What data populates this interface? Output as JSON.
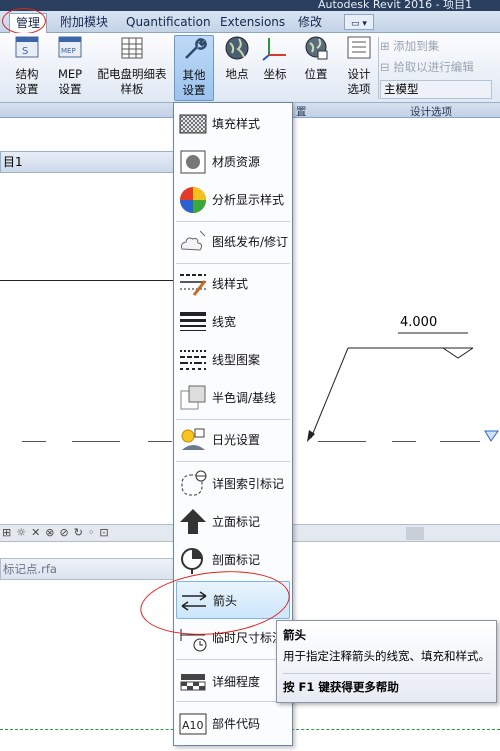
{
  "title_bar": {
    "text": "Autodesk Revit 2016 -    项目1"
  },
  "tabs": [
    {
      "label": "管理"
    },
    {
      "label": "附加模块"
    },
    {
      "label": "Quantification"
    },
    {
      "label": "Extensions"
    },
    {
      "label": "修改"
    }
  ],
  "ribbon": {
    "buttons": [
      {
        "label": "结构\n设置"
      },
      {
        "label": "MEP\n设置"
      },
      {
        "label": "配电盘明细表\n样板"
      },
      {
        "label": "其他\n设置"
      },
      {
        "label": "地点"
      },
      {
        "label": "坐标"
      },
      {
        "label": "位置"
      },
      {
        "label": "设计\n选项"
      }
    ],
    "small_commands": [
      "添加到集",
      "拾取以进行编辑",
      "主模型"
    ],
    "panel_labels": [
      "置",
      "设计选项"
    ]
  },
  "view": {
    "tab_title": "目1",
    "elevation_value": "4.000",
    "bottom_tab": "标记点.rfa"
  },
  "menu": {
    "items": [
      {
        "label": "填充样式",
        "icon": "fill-pattern-icon"
      },
      {
        "label": "材质资源",
        "icon": "material-assets-icon"
      },
      {
        "label": "分析显示样式",
        "icon": "analysis-display-icon"
      },
      {
        "label": "图纸发布/修订",
        "icon": "sheet-revision-icon"
      },
      {
        "label": "线样式",
        "icon": "line-style-icon"
      },
      {
        "label": "线宽",
        "icon": "line-weight-icon"
      },
      {
        "label": "线型图案",
        "icon": "line-pattern-icon"
      },
      {
        "label": "半色调/基线",
        "icon": "halftone-icon"
      },
      {
        "label": "日光设置",
        "icon": "sun-settings-icon"
      },
      {
        "label": "详图索引标记",
        "icon": "callout-tag-icon"
      },
      {
        "label": "立面标记",
        "icon": "elevation-tag-icon"
      },
      {
        "label": "剖面标记",
        "icon": "section-tag-icon"
      },
      {
        "label": "箭头",
        "icon": "arrowheads-icon"
      },
      {
        "label": "临时尺寸标注",
        "icon": "temp-dimension-icon"
      },
      {
        "label": "详细程度",
        "icon": "detail-level-icon"
      },
      {
        "label": "部件代码",
        "icon": "assembly-code-icon"
      }
    ]
  },
  "tooltip": {
    "title": "箭头",
    "description": "用于指定注释箭头的线宽、填充和样式。",
    "help": "按 F1 键获得更多帮助"
  },
  "colors": {
    "accent": "#2a3f5e",
    "highlight": "#cce6fb",
    "annotation_red": "#e0231f"
  }
}
